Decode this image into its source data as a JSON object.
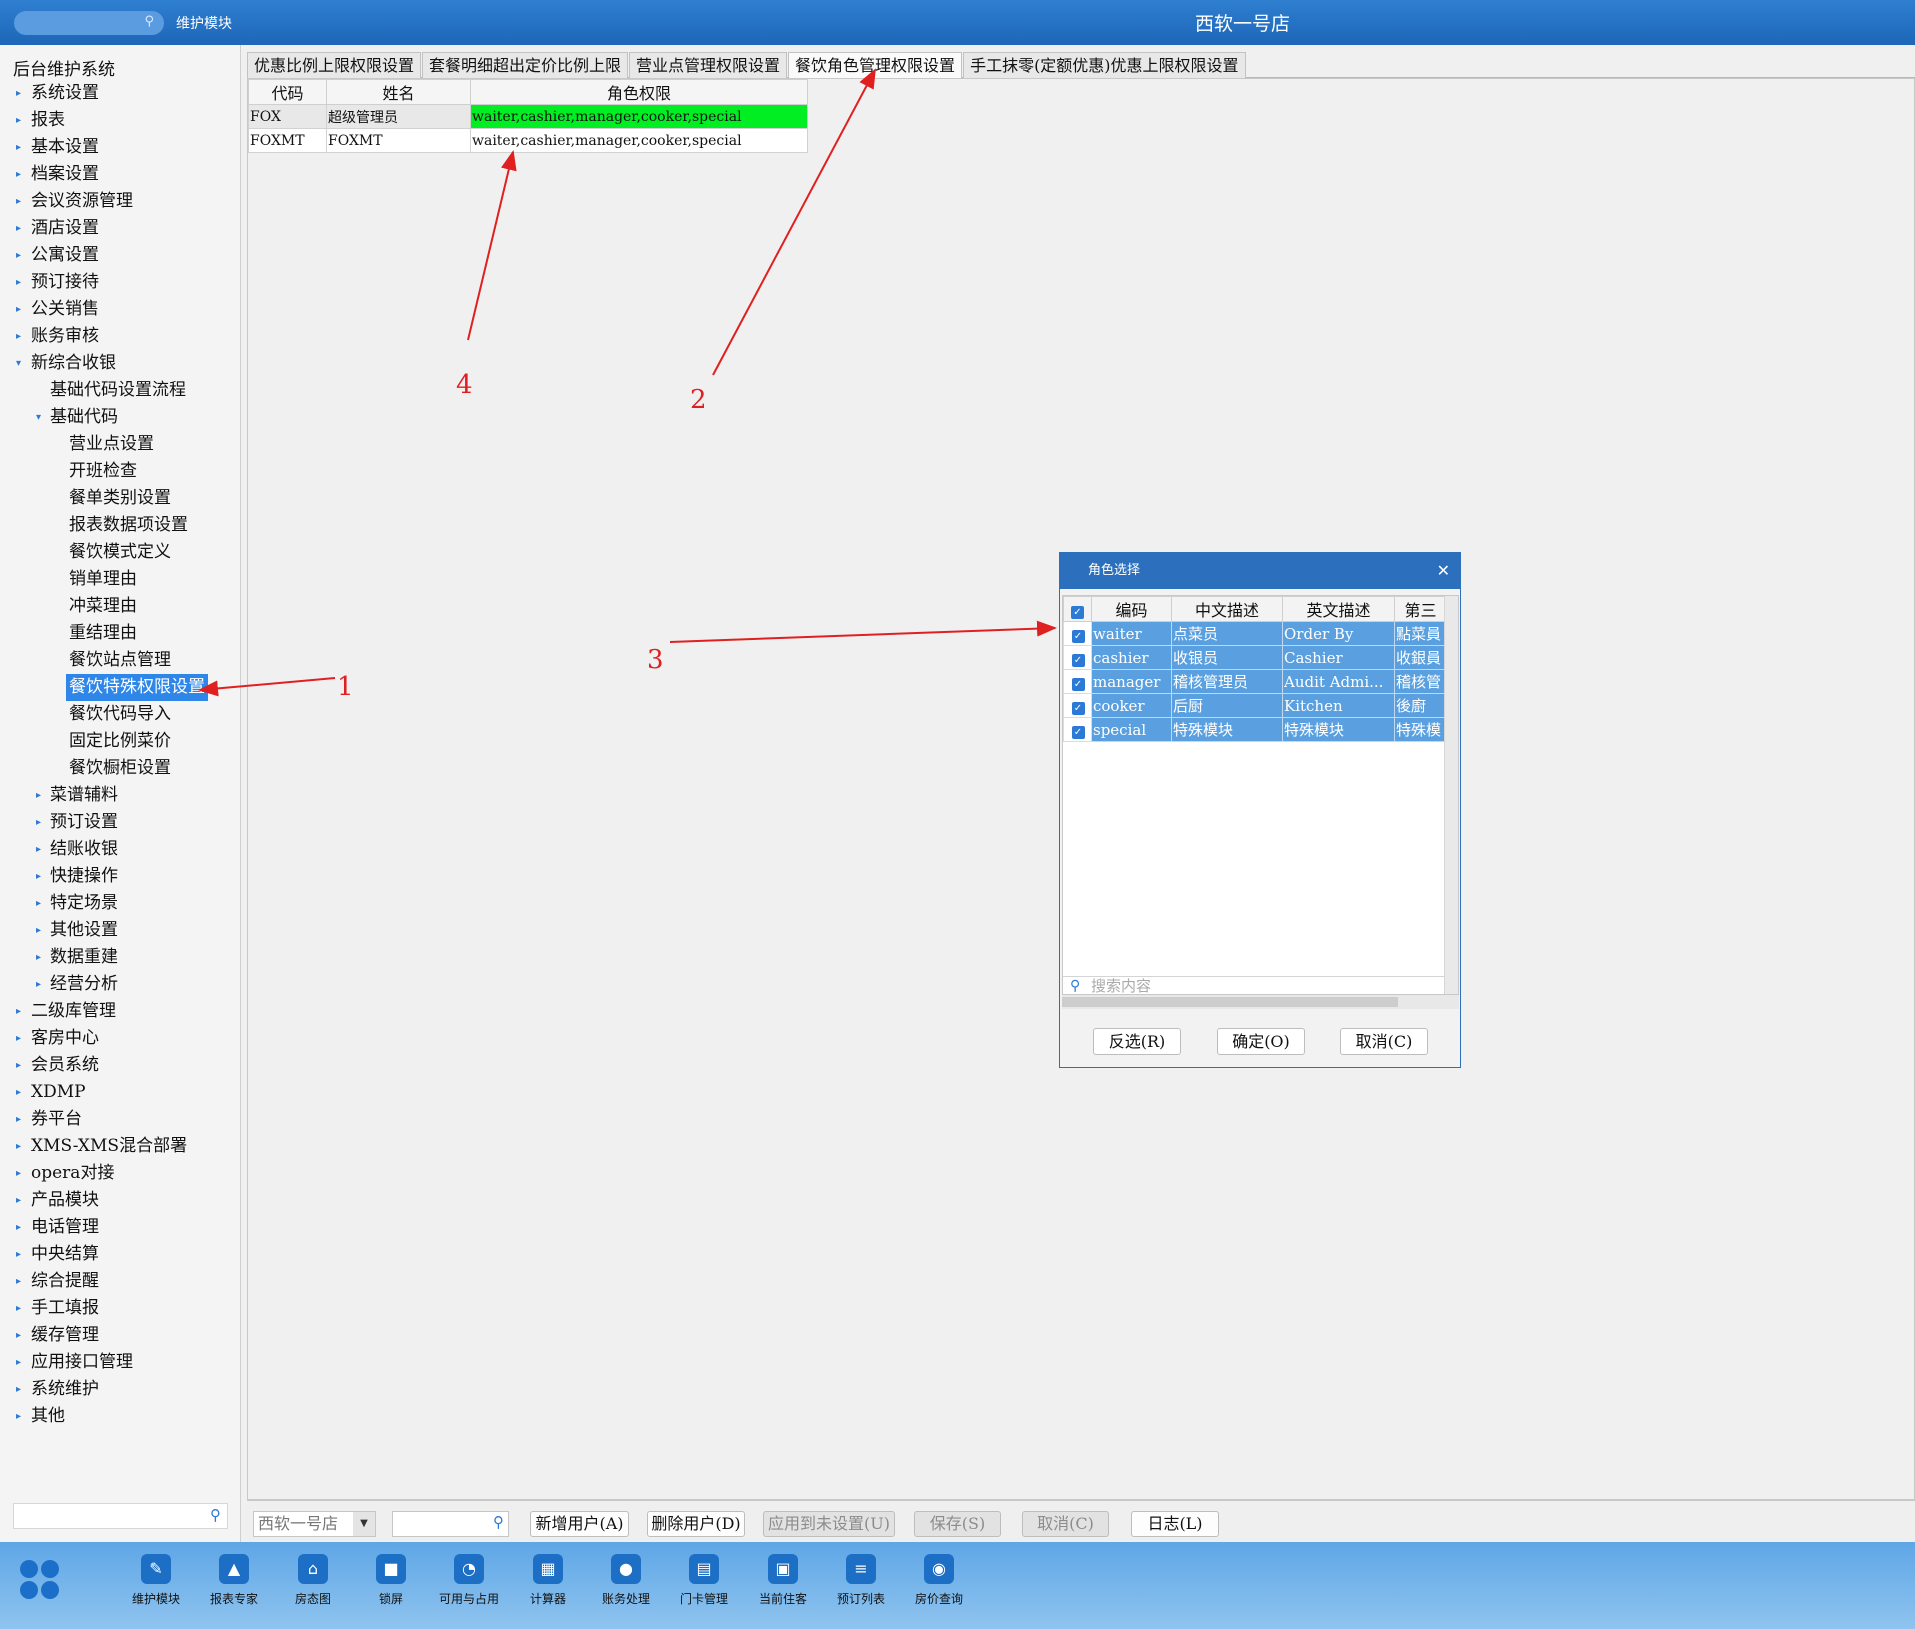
{
  "topbar": {
    "module": "维护模块",
    "hotel": "西软一号店"
  },
  "sidebar": {
    "title": "后台维护系统",
    "items": [
      {
        "label": "系统设置",
        "level": 0,
        "arrow": "▸"
      },
      {
        "label": "报表",
        "level": 0,
        "arrow": "▸"
      },
      {
        "label": "基本设置",
        "level": 0,
        "arrow": "▸"
      },
      {
        "label": "档案设置",
        "level": 0,
        "arrow": "▸"
      },
      {
        "label": "会议资源管理",
        "level": 0,
        "arrow": "▸"
      },
      {
        "label": "酒店设置",
        "level": 0,
        "arrow": "▸"
      },
      {
        "label": "公寓设置",
        "level": 0,
        "arrow": "▸"
      },
      {
        "label": "预订接待",
        "level": 0,
        "arrow": "▸"
      },
      {
        "label": "公关销售",
        "level": 0,
        "arrow": "▸"
      },
      {
        "label": "账务审核",
        "level": 0,
        "arrow": "▸"
      },
      {
        "label": "新综合收银",
        "level": 0,
        "arrow": "▾"
      },
      {
        "label": "基础代码设置流程",
        "level": 1,
        "arrow": ""
      },
      {
        "label": "基础代码",
        "level": 1,
        "arrow": "▾"
      },
      {
        "label": "营业点设置",
        "level": 2,
        "arrow": ""
      },
      {
        "label": "开班检查",
        "level": 2,
        "arrow": ""
      },
      {
        "label": "餐单类别设置",
        "level": 2,
        "arrow": ""
      },
      {
        "label": "报表数据项设置",
        "level": 2,
        "arrow": ""
      },
      {
        "label": "餐饮模式定义",
        "level": 2,
        "arrow": ""
      },
      {
        "label": "销单理由",
        "level": 2,
        "arrow": ""
      },
      {
        "label": "冲菜理由",
        "level": 2,
        "arrow": ""
      },
      {
        "label": "重结理由",
        "level": 2,
        "arrow": ""
      },
      {
        "label": "餐饮站点管理",
        "level": 2,
        "arrow": ""
      },
      {
        "label": "餐饮特殊权限设置",
        "level": 2,
        "arrow": "",
        "selected": true
      },
      {
        "label": "餐饮代码导入",
        "level": 2,
        "arrow": ""
      },
      {
        "label": "固定比例菜价",
        "level": 2,
        "arrow": ""
      },
      {
        "label": "餐饮橱柜设置",
        "level": 2,
        "arrow": ""
      },
      {
        "label": "菜谱辅料",
        "level": 1,
        "arrow": "▸"
      },
      {
        "label": "预订设置",
        "level": 1,
        "arrow": "▸"
      },
      {
        "label": "结账收银",
        "level": 1,
        "arrow": "▸"
      },
      {
        "label": "快捷操作",
        "level": 1,
        "arrow": "▸"
      },
      {
        "label": "特定场景",
        "level": 1,
        "arrow": "▸"
      },
      {
        "label": "其他设置",
        "level": 1,
        "arrow": "▸"
      },
      {
        "label": "数据重建",
        "level": 1,
        "arrow": "▸"
      },
      {
        "label": "经营分析",
        "level": 1,
        "arrow": "▸"
      },
      {
        "label": "二级库管理",
        "level": 0,
        "arrow": "▸"
      },
      {
        "label": "客房中心",
        "level": 0,
        "arrow": "▸"
      },
      {
        "label": "会员系统",
        "level": 0,
        "arrow": "▸"
      },
      {
        "label": "XDMP",
        "level": 0,
        "arrow": "▸"
      },
      {
        "label": "券平台",
        "level": 0,
        "arrow": "▸"
      },
      {
        "label": "XMS-XMS混合部署",
        "level": 0,
        "arrow": "▸"
      },
      {
        "label": "opera对接",
        "level": 0,
        "arrow": "▸"
      },
      {
        "label": "产品模块",
        "level": 0,
        "arrow": "▸"
      },
      {
        "label": "电话管理",
        "level": 0,
        "arrow": "▸"
      },
      {
        "label": "中央结算",
        "level": 0,
        "arrow": "▸"
      },
      {
        "label": "综合提醒",
        "level": 0,
        "arrow": "▸"
      },
      {
        "label": "手工填报",
        "level": 0,
        "arrow": "▸"
      },
      {
        "label": "缓存管理",
        "level": 0,
        "arrow": "▸"
      },
      {
        "label": "应用接口管理",
        "level": 0,
        "arrow": "▸"
      },
      {
        "label": "系统维护",
        "level": 0,
        "arrow": "▸"
      },
      {
        "label": "其他",
        "level": 0,
        "arrow": "▸"
      }
    ]
  },
  "tabs": [
    {
      "label": "优惠比例上限权限设置",
      "active": false
    },
    {
      "label": "套餐明细超出定价比例上限",
      "active": false
    },
    {
      "label": "营业点管理权限设置",
      "active": false
    },
    {
      "label": "餐饮角色管理权限设置",
      "active": true
    },
    {
      "label": "手工抹零(定额优惠)优惠上限权限设置",
      "active": false
    }
  ],
  "grid": {
    "headers": [
      "代码",
      "姓名",
      "角色权限"
    ],
    "rows": [
      [
        "FOX",
        "超级管理员",
        "waiter,cashier,manager,cooker,special"
      ],
      [
        "FOXMT",
        "FOXMT",
        "waiter,cashier,manager,cooker,special"
      ]
    ]
  },
  "bottom": {
    "hotel_select": "西软一号店",
    "buttons": [
      {
        "label": "新增用户(A)",
        "disabled": false
      },
      {
        "label": "删除用户(D)",
        "disabled": false
      },
      {
        "label": "应用到未设置(U)",
        "disabled": true
      },
      {
        "label": "保存(S)",
        "disabled": true
      },
      {
        "label": "取消(C)",
        "disabled": true
      },
      {
        "label": "日志(L)",
        "disabled": false
      }
    ]
  },
  "taskbar": [
    {
      "label": "维护模块",
      "icon": "wrench-icon",
      "glyph": "✎"
    },
    {
      "label": "报表专家",
      "icon": "graduation-cap-icon",
      "glyph": "▲"
    },
    {
      "label": "房态图",
      "icon": "bank-icon",
      "glyph": "⌂"
    },
    {
      "label": "锁屏",
      "icon": "lock-icon",
      "glyph": "■"
    },
    {
      "label": "可用与占用",
      "icon": "pie-chart-icon",
      "glyph": "◔"
    },
    {
      "label": "计算器",
      "icon": "calculator-icon",
      "glyph": "▦"
    },
    {
      "label": "账务处理",
      "icon": "chat-icon",
      "glyph": "●"
    },
    {
      "label": "门卡管理",
      "icon": "card-icon",
      "glyph": "▤"
    },
    {
      "label": "当前住客",
      "icon": "id-card-icon",
      "glyph": "▣"
    },
    {
      "label": "预订列表",
      "icon": "list-icon",
      "glyph": "≡"
    },
    {
      "label": "房价查询",
      "icon": "database-icon",
      "glyph": "◉"
    }
  ],
  "dialog": {
    "title": "角色选择",
    "headers": [
      "编码",
      "中文描述",
      "英文描述",
      "第三"
    ],
    "rows": [
      [
        "waiter",
        "点菜员",
        "Order By",
        "點菜員"
      ],
      [
        "cashier",
        "收银员",
        "Cashier",
        "收銀員"
      ],
      [
        "manager",
        "稽核管理员",
        "Audit Admi...",
        "稽核管"
      ],
      [
        "cooker",
        "后厨",
        "Kitchen",
        "後廚"
      ],
      [
        "special",
        "特殊模块",
        "特殊模块",
        "特殊模"
      ]
    ],
    "search_placeholder": "搜索内容",
    "buttons": [
      "反选(R)",
      "确定(O)",
      "取消(C)"
    ]
  },
  "annotations": [
    "1",
    "2",
    "3",
    "4"
  ],
  "colors": {
    "accent": "#2b6fbd",
    "highlight": "#00ee22",
    "selection": "#5aa0e0",
    "annotation": "#e02020"
  }
}
